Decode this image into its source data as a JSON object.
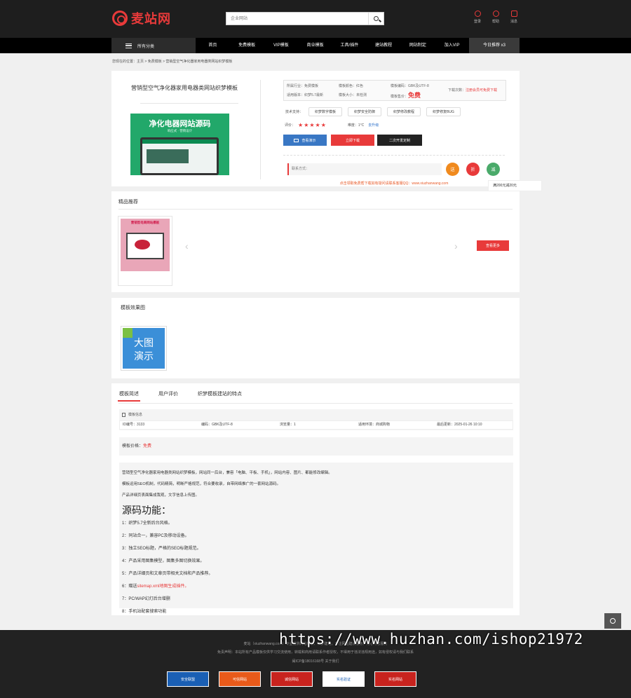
{
  "header": {
    "logo_text": "麦站网",
    "search_placeholder": "企业网站",
    "icons": [
      {
        "name": "user-icon",
        "label": "登录"
      },
      {
        "name": "help-icon",
        "label": "帮助"
      },
      {
        "name": "message-icon",
        "label": "消息"
      }
    ]
  },
  "nav": {
    "category_label": "所有分类",
    "items": [
      "首页",
      "免费模板",
      "VIP模板",
      "商业模板",
      "工具/插件",
      "建站教程",
      "网站制定",
      "加入VIP"
    ],
    "today_label": "今日推荐  x3"
  },
  "breadcrumb": "您现在的位置：主页 > 免费模板 > 营销型空气净化器家用电器类网站织梦模板",
  "product": {
    "title": "营销型空气净化器家用电器类网站织梦模板",
    "image_title": "净化电器网站源码",
    "image_subtitle": "响应式 · 营销设计",
    "info": {
      "industry": "所属行业：免费模板",
      "version": "适用版本：织梦5.7最新",
      "color": "模板颜色：红色",
      "size": "模板大小：未检测",
      "encoding": "模板编码：GBK及UTF-8",
      "price_label": "模板售价：",
      "price": "免费",
      "download_label": "下载次数：",
      "download_value": "注册会员可免费下载"
    },
    "tags_label": "技术支持：",
    "tags": [
      "织梦数字模板",
      "织梦安全防御",
      "织梦修改教程",
      "织梦修复BUG"
    ],
    "rating_label": "评价：",
    "stars": "★★★★★",
    "difficulty": "难度：1°C",
    "upgrade": "去升级",
    "buttons": {
      "preview": "查看演示",
      "download": "立即下载",
      "custom": "二次开发定制"
    },
    "contact_label": "联系方式：",
    "contact_circles": [
      "送",
      "折",
      "减"
    ],
    "notice": "点击领取免费帮下载如有疑问请联系客服QQ：www.xiuzhanwang.com",
    "tooltip": "满200元减20元"
  },
  "recommend": {
    "title": "精品推荐",
    "thumb_title": "营销型电商网站模板",
    "more_button": "查看更多"
  },
  "preview": {
    "title": "模板效果图",
    "image_text_line1": "大图",
    "image_text_line2": "演示"
  },
  "detail": {
    "tabs": [
      "模板简述",
      "用户评价",
      "织梦模板建站的特点"
    ],
    "attr_header": "模板信息",
    "attrs": [
      "ID编号：3133",
      "编码：GBK及UTF-8",
      "浏览量：1",
      "适用环境：商城购物",
      "最后更新：2025-01-26 10:10"
    ],
    "price_label": "模板价格：",
    "price_value": "免费",
    "paragraphs": [
      "营销型空气净化器家用电器类网站织梦模板，网站同一后台，兼容「电脑、平板、手机」，网站内容、图片、都能修改编辑。",
      "模板运用SEO机制，代码精简，明晰严格规范，符合要收录，自带网络推广的一套网站源码。",
      "产品详细页表面集成我观，文字信息上传图。"
    ],
    "features_title": "源码功能：",
    "features": [
      "1：织梦5.7全新后台风格。",
      "2：同站合一，兼容PC及移动设备。",
      "3：独立SEO标题，严格的SEO标题规范。",
      "4：产品采用图集模型，图集多图切换效果。",
      "5：产品详细页和文章页带相关文档和产品推荐。",
      "6：赠送",
      "7：PC/WAP幻灯后台增删",
      "8：手机站配套搜索功能"
    ],
    "sitemap_link": "sitemap.xml地图生成插件。"
  },
  "footer": {
    "line1": "麦站（xiuzhanwang.com）专业提供网站模板、织梦建站，专注网站建设服务，用心为您服务",
    "line2": "免责声明：本站所有产品模板仅供学习交流使用，转载和商用请联系作者授权，不得用于违法违规用途，如有侵权请与我们联系",
    "line3": "闽ICP备18016168号  关于我们",
    "badges": [
      "安全联盟",
      "可信网站",
      "诚信网站",
      "实名验证",
      "实名网站"
    ]
  },
  "watermark": "https://www.huzhan.com/ishop21972"
}
